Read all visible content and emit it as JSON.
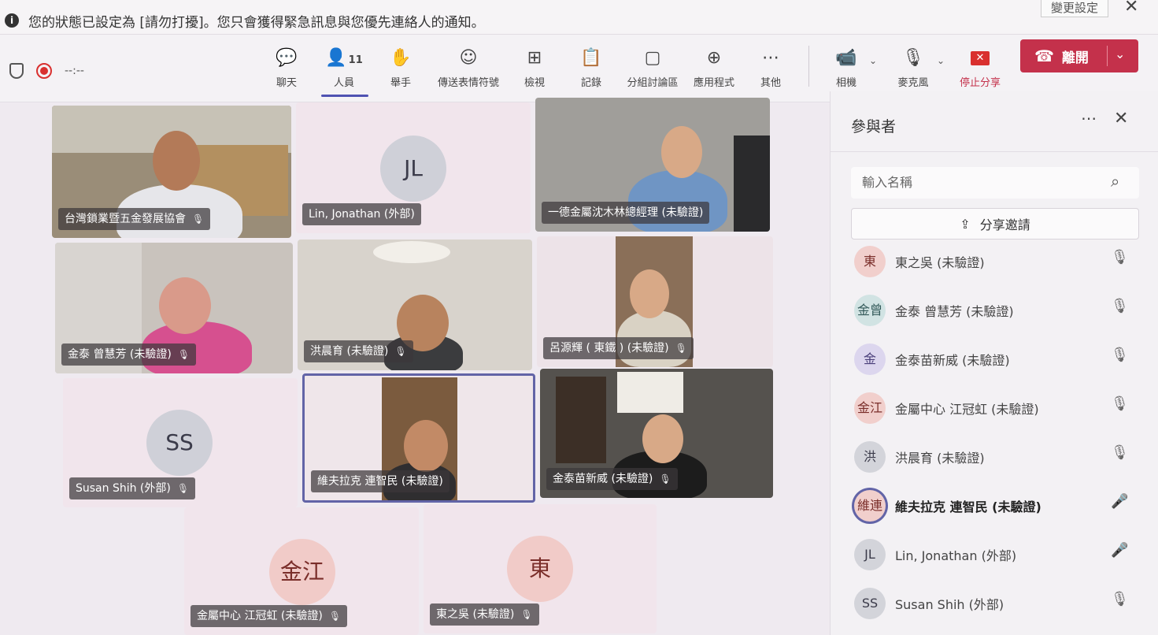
{
  "notification": {
    "text": "您的狀態已設定為 [請勿打擾]。您只會獲得緊急訊息與您優先連絡人的通知。",
    "change_button": "變更設定"
  },
  "toolbar": {
    "timer": "--:--",
    "chat": "聊天",
    "people": "人員",
    "people_count": "11",
    "raise_hand": "舉手",
    "reactions": "傳送表情符號",
    "view": "檢視",
    "notes": "記錄",
    "rooms": "分組討論區",
    "apps": "應用程式",
    "more": "其他",
    "camera": "相機",
    "mic": "麥克風",
    "stop_share": "停止分享",
    "leave": "離開"
  },
  "tiles": [
    {
      "name": "台灣鎖業暨五金發展協會"
    },
    {
      "name": "Lin, Jonathan (外部)",
      "initials": "JL"
    },
    {
      "name": "一德金屬沈木林總經理 (未驗證)"
    },
    {
      "name": "金泰 曾慧芳 (未驗證)"
    },
    {
      "name": "洪晨育 (未驗證)"
    },
    {
      "name": "呂源輝 ( 東鐵 ) (未驗證)"
    },
    {
      "name": "Susan Shih (外部)",
      "initials": "SS"
    },
    {
      "name": "維夫拉克 連智民 (未驗證)"
    },
    {
      "name": "金泰苗新威 (未驗證)"
    },
    {
      "name": "金屬中心 江冠虹 (未驗證)",
      "initials": "金江"
    },
    {
      "name": "東之吳 (未驗證)",
      "initials": "東"
    }
  ],
  "panel": {
    "title": "參與者",
    "search_placeholder": "輸入名稱",
    "share_invite": "分享邀請",
    "participants": [
      {
        "initials": "東",
        "name": "東之吳 (未驗證)"
      },
      {
        "initials": "金曾",
        "name": "金泰 曾慧芳 (未驗證)"
      },
      {
        "initials": "金",
        "name": "金泰苗新威 (未驗證)"
      },
      {
        "initials": "金江",
        "name": "金屬中心 江冠虹 (未驗證)"
      },
      {
        "initials": "洪",
        "name": "洪晨育 (未驗證)"
      },
      {
        "initials": "維連",
        "name": "維夫拉克 連智民 (未驗證)"
      },
      {
        "initials": "JL",
        "name": "Lin, Jonathan (外部)"
      },
      {
        "initials": "SS",
        "name": "Susan Shih (外部)"
      }
    ]
  },
  "colors": {
    "accent": "#6264a7",
    "leave": "#c4314b",
    "stop_share": "#d9302f"
  }
}
